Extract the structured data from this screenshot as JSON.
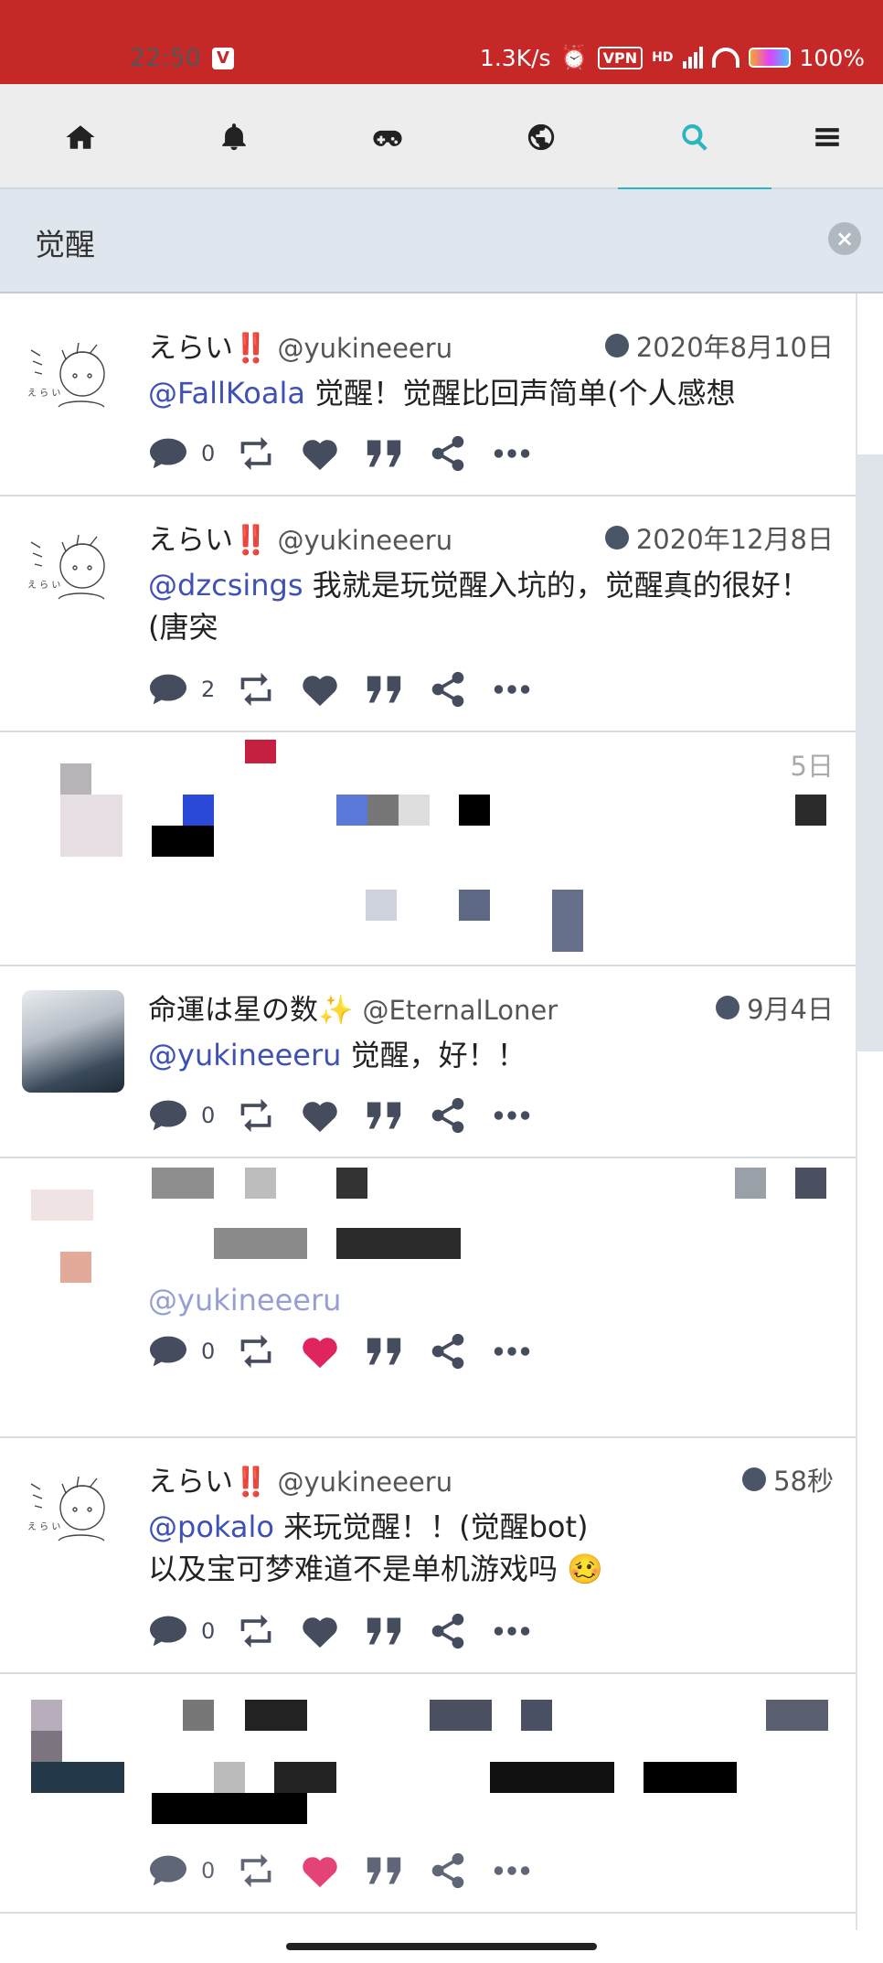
{
  "status": {
    "time": "22:50",
    "v_badge": "V",
    "speed": "1.3K/s",
    "vpn": "VPN",
    "network": "HD",
    "battery": "100%"
  },
  "nav": {
    "tabs": [
      {
        "name": "home-icon"
      },
      {
        "name": "bell-icon"
      },
      {
        "name": "gamepad-icon"
      },
      {
        "name": "globe-icon"
      },
      {
        "name": "search-icon",
        "active": true
      },
      {
        "name": "menu-icon"
      }
    ],
    "accent": "#2bb5c0"
  },
  "search": {
    "query": "觉醒",
    "clear_icon": "close-circle-icon"
  },
  "posts": [
    {
      "display_name": "えらい",
      "mark": "‼️",
      "username": "@yukineeeru",
      "time": "2020年8月10日",
      "mention": "@FallKoala",
      "text": " 觉醒！觉醒比回声简单(个人感想",
      "reply_count": "0"
    },
    {
      "display_name": "えらい",
      "mark": "‼️",
      "username": "@yukineeeru",
      "time": "2020年12月8日",
      "mention": "@dzcsings",
      "text": " 我就是玩觉醒入坑的，觉醒真的很好！(唐突",
      "reply_count": "2"
    },
    {
      "time": "5日",
      "blurred": true
    },
    {
      "display_name": "命運は星の数",
      "mark": "✨",
      "username": "@EternalLoner",
      "time": "9月4日",
      "mention": "@yukineeeru",
      "text": " 觉醒，好！！",
      "reply_count": "0"
    },
    {
      "mention": "@yukineeeru",
      "reply_count": "0",
      "blurred": true,
      "liked": true
    },
    {
      "display_name": "えらい",
      "mark": "‼️",
      "username": "@yukineeeru",
      "time": "58秒",
      "mention": "@pokalo",
      "text": " 来玩觉醒！！(觉醒bot)",
      "text2": "以及宝可梦难道不是单机游戏吗",
      "emoji": "🥴",
      "reply_count": "0"
    },
    {
      "reply_count": "0",
      "blurred": true,
      "liked": true
    }
  ]
}
